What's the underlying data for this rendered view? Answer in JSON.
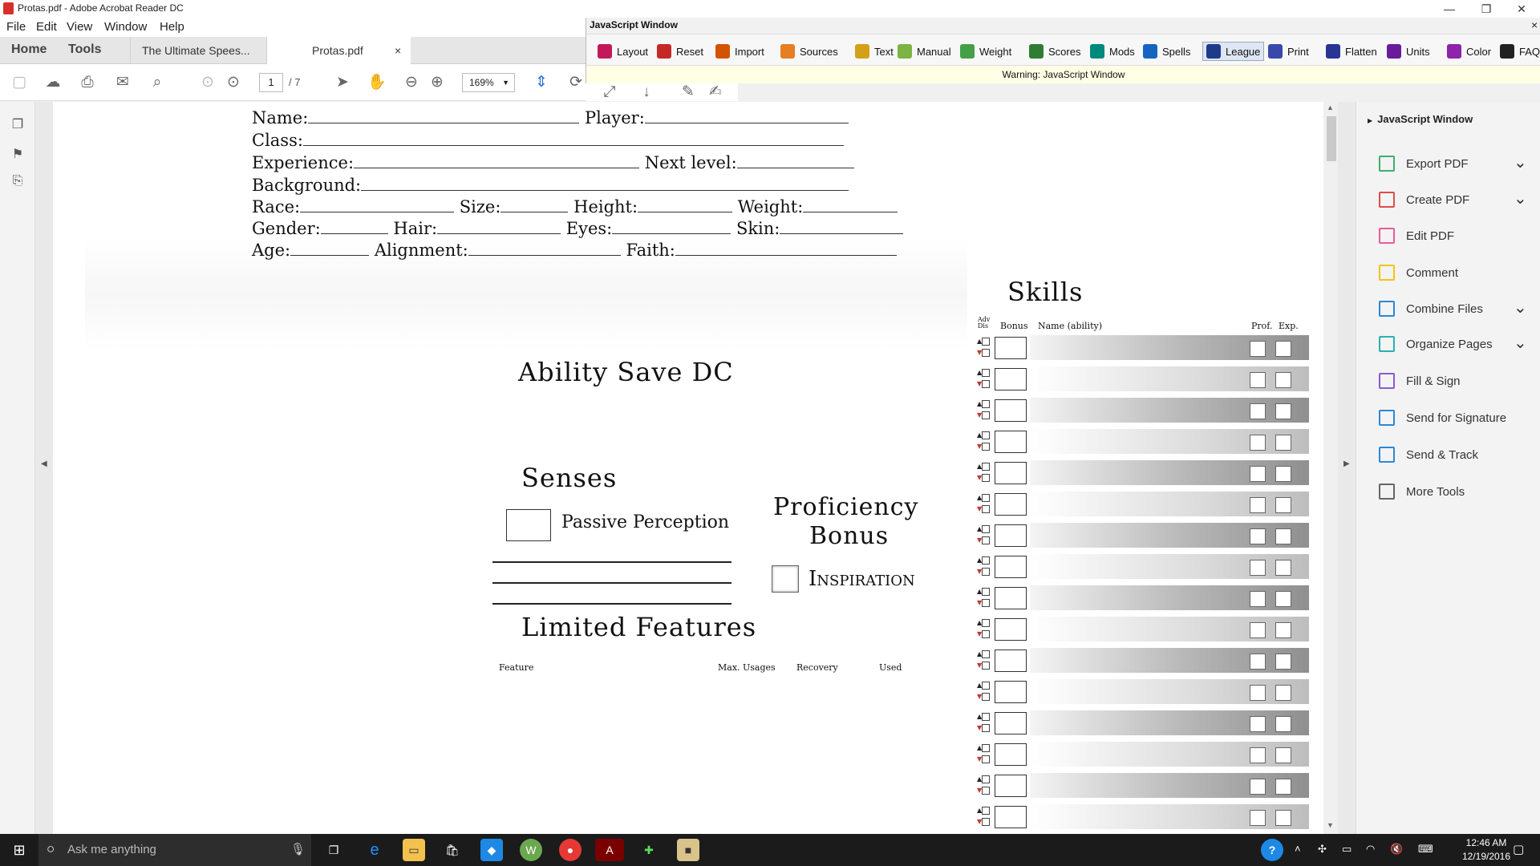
{
  "window": {
    "title": "Protas.pdf - Adobe Acrobat Reader DC",
    "controls": [
      "—",
      "❐",
      "✕"
    ]
  },
  "menu": [
    "File",
    "Edit",
    "View",
    "Window",
    "Help"
  ],
  "nav_tabs": [
    "Home",
    "Tools"
  ],
  "doc_tabs": [
    {
      "label": "The Ultimate Spees...",
      "active": false
    },
    {
      "label": "Protas.pdf",
      "active": true
    }
  ],
  "tab_close": "×",
  "toolbar": {
    "page_current": "1",
    "page_total": "/ 7",
    "zoom": "169%"
  },
  "js_window": {
    "title": "JavaScript Window",
    "close": "×",
    "buttons": [
      {
        "label": "Layout",
        "icon": "layout-icon",
        "color": "#c2185b",
        "active": false
      },
      {
        "label": "Reset",
        "icon": "power-icon",
        "color": "#c62828",
        "active": false
      },
      {
        "label": "Import",
        "icon": "import-icon",
        "color": "#d35400",
        "active": false
      },
      {
        "label": "Sources",
        "icon": "book-icon",
        "color": "#e67e22",
        "active": false
      },
      {
        "label": "Text",
        "icon": "text-icon",
        "color": "#d4a017",
        "active": false
      },
      {
        "label": "Manual",
        "icon": "manual-icon",
        "color": "#7cb342",
        "active": false
      },
      {
        "label": "Weight",
        "icon": "weight-icon",
        "color": "#43a047",
        "active": false
      },
      {
        "label": "Scores",
        "icon": "scores-icon",
        "color": "#2e7d32",
        "active": false
      },
      {
        "label": "Mods",
        "icon": "mods-icon",
        "color": "#00897b",
        "active": false
      },
      {
        "label": "Spells",
        "icon": "spells-icon",
        "color": "#1565c0",
        "active": false
      },
      {
        "label": "League",
        "icon": "league-icon",
        "color": "#1e3a8a",
        "active": true
      },
      {
        "label": "Print",
        "icon": "print-icon",
        "color": "#3949ab",
        "active": false
      },
      {
        "label": "Flatten",
        "icon": "flatten-icon",
        "color": "#283593",
        "active": false
      },
      {
        "label": "Units",
        "icon": "units-icon",
        "color": "#6a1b9a",
        "active": false
      },
      {
        "label": "Color",
        "icon": "color-icon",
        "color": "#8e24aa",
        "active": false
      },
      {
        "label": "FAQ",
        "icon": "faq-icon",
        "color": "#212121",
        "active": false
      }
    ],
    "warning": "Warning: JavaScript Window"
  },
  "right_pane": {
    "header": "JavaScript Window",
    "items": [
      {
        "label": "Export PDF",
        "icon": "export-pdf-icon",
        "color": "#3fae6e",
        "chevron": true
      },
      {
        "label": "Create PDF",
        "icon": "create-pdf-icon",
        "color": "#e14b4b",
        "chevron": true
      },
      {
        "label": "Edit PDF",
        "icon": "edit-pdf-icon",
        "color": "#e95b9a",
        "chevron": false
      },
      {
        "label": "Comment",
        "icon": "comment-icon",
        "color": "#f2c314",
        "chevron": false
      },
      {
        "label": "Combine Files",
        "icon": "combine-icon",
        "color": "#2a88d8",
        "chevron": true
      },
      {
        "label": "Organize Pages",
        "icon": "organize-icon",
        "color": "#2bb0b0",
        "chevron": true
      },
      {
        "label": "Fill & Sign",
        "icon": "fill-sign-icon",
        "color": "#8b5ad4",
        "chevron": false
      },
      {
        "label": "Send for Signature",
        "icon": "send-signature-icon",
        "color": "#2a88d8",
        "chevron": false
      },
      {
        "label": "Send & Track",
        "icon": "send-track-icon",
        "color": "#2a88d8",
        "chevron": false
      },
      {
        "label": "More Tools",
        "icon": "plus-circle-icon",
        "color": "#666666",
        "chevron": false
      }
    ]
  },
  "sheet": {
    "fields": {
      "name": "Name:",
      "player": "Player:",
      "class": "Class:",
      "experience": "Experience:",
      "next_level": "Next level:",
      "background": "Background:",
      "race": "Race:",
      "size": "Size:",
      "height": "Height:",
      "weight": "Weight:",
      "gender": "Gender:",
      "hair": "Hair:",
      "eyes": "Eyes:",
      "skin": "Skin:",
      "age": "Age:",
      "alignment": "Alignment:",
      "faith": "Faith:"
    },
    "ability_save_dc": "Ability Save DC",
    "senses": "Senses",
    "passive_perception": "Passive Perception",
    "proficiency_bonus_1": "Proficiency",
    "proficiency_bonus_2": "Bonus",
    "inspiration": "Inspiration",
    "limited_features": "Limited Features",
    "lf_columns": [
      "Feature",
      "Max. Usages",
      "Recovery",
      "Used"
    ],
    "skills": "Skills",
    "skills_columns": {
      "adv_dis": "Adv Dis",
      "bonus": "Bonus",
      "name": "Name (ability)",
      "prof": "Prof.",
      "exp": "Exp."
    },
    "skill_rows": 16
  },
  "taskbar": {
    "search_placeholder": "Ask me anything",
    "time": "12:46 AM",
    "date": "12/19/2016"
  }
}
